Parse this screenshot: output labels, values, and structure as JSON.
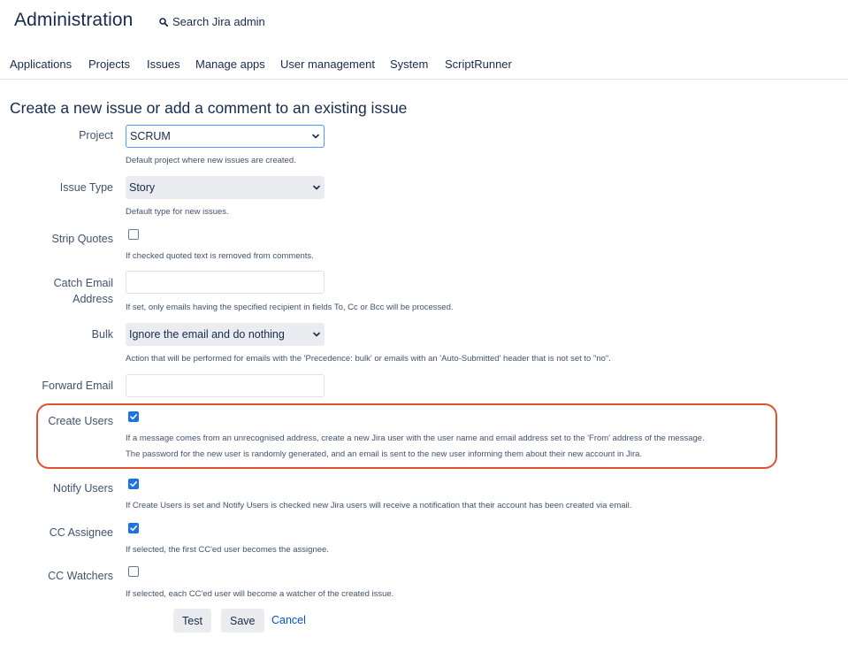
{
  "header": {
    "title": "Administration",
    "search_label": "Search Jira admin"
  },
  "nav": {
    "items": [
      "Applications",
      "Projects",
      "Issues",
      "Manage apps",
      "User management",
      "System",
      "ScriptRunner"
    ]
  },
  "page": {
    "title": "Create a new issue or add a comment to an existing issue"
  },
  "form": {
    "project": {
      "label": "Project",
      "value": "SCRUM",
      "description": "Default project where new issues are created."
    },
    "issue_type": {
      "label": "Issue Type",
      "value": "Story",
      "description": "Default type for new issues."
    },
    "strip_quotes": {
      "label": "Strip Quotes",
      "checked": false,
      "description": "If checked quoted text is removed from comments."
    },
    "catch_email": {
      "label_line1": "Catch Email",
      "label_line2": "Address",
      "value": "",
      "description": "If set, only emails having the specified recipient in fields To, Cc or Bcc will be processed."
    },
    "bulk": {
      "label": "Bulk",
      "value": "Ignore the email and do nothing",
      "description": "Action that will be performed for emails with the 'Precedence: bulk' or emails with an 'Auto-Submitted' header that is not set to \"no\"."
    },
    "forward_email": {
      "label": "Forward Email",
      "value": ""
    },
    "create_users": {
      "label": "Create Users",
      "checked": true,
      "description_line1": "If a message comes from an unrecognised address, create a new Jira user with the user name and email address set to the 'From' address of the message.",
      "description_line2": "The password for the new user is randomly generated, and an email is sent to the new user informing them about their new account in Jira."
    },
    "notify_users": {
      "label": "Notify Users",
      "checked": true,
      "description": "If Create Users is set and Notify Users is checked new Jira users will receive a notification that their account has been created via email."
    },
    "cc_assignee": {
      "label": "CC Assignee",
      "checked": true,
      "description": "If selected, the first CC'ed user becomes the assignee."
    },
    "cc_watchers": {
      "label": "CC Watchers",
      "checked": false,
      "description": "If selected, each CC'ed user will become a watcher of the created issue."
    }
  },
  "actions": {
    "test_label": "Test",
    "save_label": "Save",
    "cancel_label": "Cancel"
  },
  "colors": {
    "highlight": "#e0512f",
    "link": "#0052cc",
    "checkbox": "#1a73e8"
  }
}
